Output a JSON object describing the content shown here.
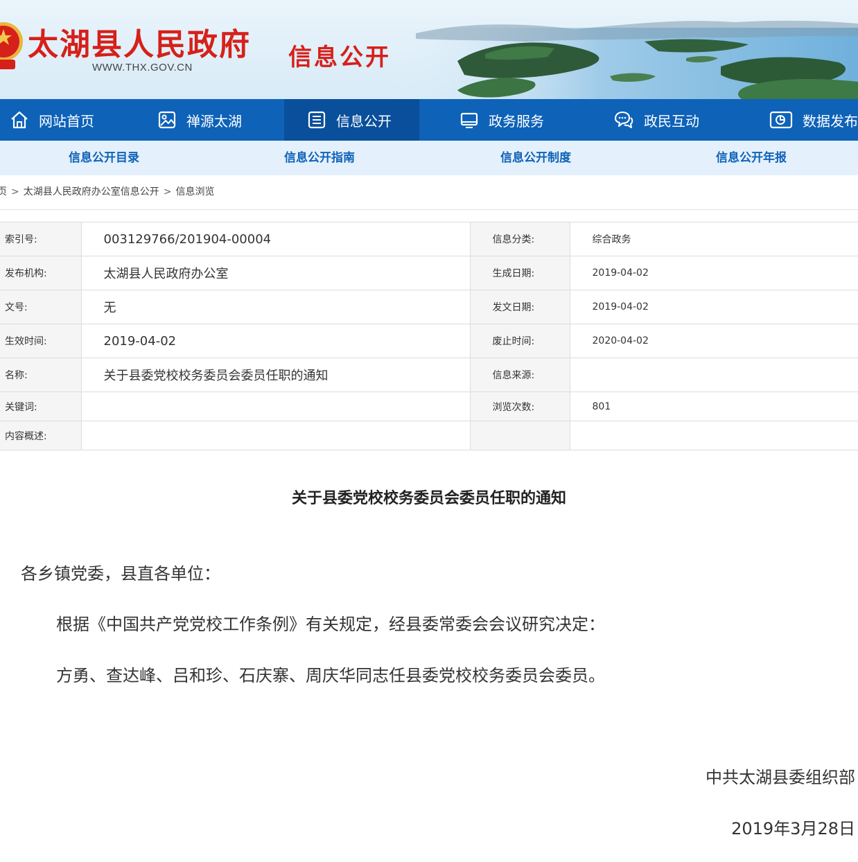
{
  "header": {
    "site_name": "太湖县人民政府",
    "site_url": "WWW.THX.GOV.CN",
    "section_title": "信息公开"
  },
  "nav": {
    "items": [
      {
        "label": "网站首页",
        "icon": "home-icon"
      },
      {
        "label": "禅源太湖",
        "icon": "picture-icon"
      },
      {
        "label": "信息公开",
        "icon": "document-list-icon",
        "active": true
      },
      {
        "label": "政务服务",
        "icon": "monitor-icon"
      },
      {
        "label": "政民互动",
        "icon": "chat-bubbles-icon"
      },
      {
        "label": "数据发布",
        "icon": "pie-chart-icon"
      }
    ]
  },
  "subnav": {
    "items": [
      "信息公开目录",
      "信息公开指南",
      "信息公开制度",
      "信息公开年报"
    ]
  },
  "breadcrumb": {
    "items": [
      "页",
      "太湖县人民政府办公室信息公开",
      "信息浏览"
    ],
    "separator": ">"
  },
  "meta": {
    "rows": [
      {
        "label1": "索引号:",
        "value1": "003129766/201904-00004",
        "label2": "信息分类:",
        "value2": "综合政务"
      },
      {
        "label1": "发布机构:",
        "value1": "太湖县人民政府办公室",
        "label2": "生成日期:",
        "value2": "2019-04-02"
      },
      {
        "label1": "文号:",
        "value1": "无",
        "label2": "发文日期:",
        "value2": "2019-04-02"
      },
      {
        "label1": "生效时间:",
        "value1": "2019-04-02",
        "label2": "废止时间:",
        "value2": "2020-04-02"
      },
      {
        "label1": "名称:",
        "value1": "关于县委党校校务委员会委员任职的通知",
        "label2": "信息来源:",
        "value2": ""
      },
      {
        "label1": "关键词:",
        "value1": "",
        "label2": "浏览次数:",
        "value2": "801"
      },
      {
        "label1": "内容概述:",
        "value1": "",
        "label2": "",
        "value2": ""
      }
    ]
  },
  "article": {
    "title": "关于县委党校校务委员会委员任职的通知",
    "greeting": "各乡镇党委，县直各单位：",
    "paragraphs": [
      "根据《中国共产党党校工作条例》有关规定，经县委常委会会议研究决定：",
      "方勇、查达峰、吕和珍、石庆寨、周庆华同志任县委党校校务委员会委员。"
    ],
    "signature": "中共太湖县委组织部",
    "date": "2019年3月28日"
  },
  "colors": {
    "brand_red": "#d6201a",
    "nav_blue": "#0e62b8",
    "nav_active": "#0a4f9b",
    "subnav_bg": "#e4f0fb"
  }
}
